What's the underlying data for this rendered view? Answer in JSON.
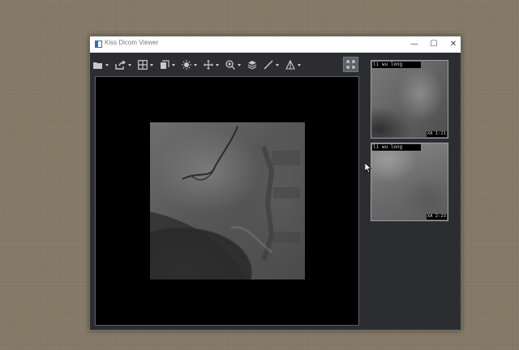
{
  "window": {
    "title": "Kiss Dicom Viewer",
    "controls": {
      "minimize": "—",
      "maximize": "☐",
      "close": "✕"
    }
  },
  "toolbar": {
    "tools": [
      {
        "name": "open-icon",
        "has_dropdown": true
      },
      {
        "name": "export-icon",
        "has_dropdown": true
      },
      {
        "name": "layout-grid-icon",
        "has_dropdown": true
      },
      {
        "name": "series-icon",
        "has_dropdown": true
      },
      {
        "name": "brightness-icon",
        "has_dropdown": true
      },
      {
        "name": "pan-icon",
        "has_dropdown": true
      },
      {
        "name": "zoom-icon",
        "has_dropdown": true
      },
      {
        "name": "layers-icon",
        "has_dropdown": false
      },
      {
        "name": "line-measure-icon",
        "has_dropdown": true
      },
      {
        "name": "angle-measure-icon",
        "has_dropdown": true
      }
    ],
    "fit_button": "fit-window-icon"
  },
  "thumbnails": [
    {
      "patient": "li wu long",
      "info": "XA 1:21"
    },
    {
      "patient": "li wu long",
      "info": "XA 2:23"
    }
  ],
  "colors": {
    "window_bg": "#2b2d31",
    "viewport_bg": "#000000",
    "accent_border": "#9aa0a8"
  }
}
